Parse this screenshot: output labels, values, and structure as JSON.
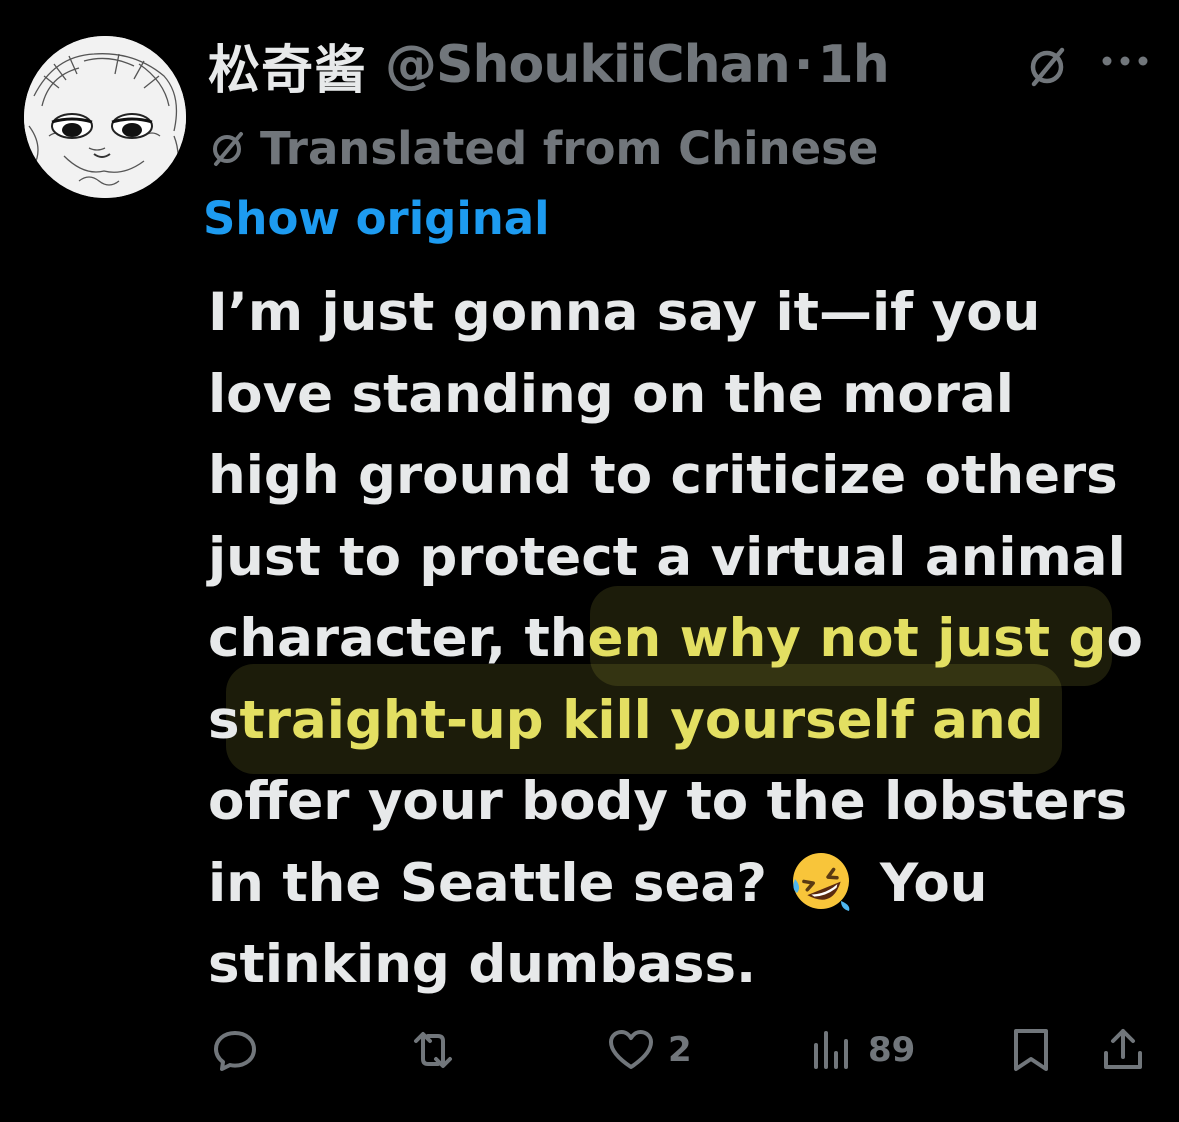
{
  "tweet": {
    "display_name": "松奇酱",
    "handle": "@ShoukiiChan",
    "separator": "·",
    "time": "1h",
    "translated_label": "Translated from Chinese",
    "show_original": "Show original",
    "text_lines": [
      {
        "before": "I’m just gonna say it—if you",
        "hl": "",
        "after": ""
      },
      {
        "before": "love standing on the moral",
        "hl": "",
        "after": ""
      },
      {
        "before": "high ground to criticize others",
        "hl": "",
        "after": ""
      },
      {
        "before": "just to protect a virtual animal",
        "hl": "",
        "after": ""
      },
      {
        "before": "character, th",
        "hl": "en why not just g",
        "after": "o"
      },
      {
        "before": "s",
        "hl": "traight-up kill yourself and",
        "after": ""
      },
      {
        "before": "offer your body to the lobsters",
        "hl": "",
        "after": ""
      },
      {
        "before": "in the Seattle sea? ",
        "hl": "",
        "after": " You"
      },
      {
        "before": "stinking dumbass.",
        "hl": "",
        "after": ""
      }
    ],
    "emoji": "rofl-emoji",
    "highlight_color": "#e3df62"
  },
  "actions": {
    "reply_count": "",
    "repost_count": "",
    "like_count": "2",
    "views_count": "89"
  },
  "colors": {
    "background": "#000000",
    "text": "#e7e9ea",
    "muted": "#71767b",
    "link": "#1d9bf0"
  }
}
